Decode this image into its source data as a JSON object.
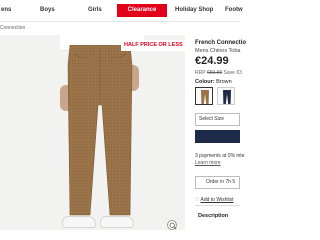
{
  "nav": {
    "items": [
      {
        "label": "ens"
      },
      {
        "label": "Boys"
      },
      {
        "label": "Girls"
      },
      {
        "label": "Clearance"
      },
      {
        "label": "Holiday Shop"
      },
      {
        "label": "Footw"
      }
    ],
    "active_color": "#e3001b"
  },
  "breadcrumb": "Connection",
  "product": {
    "promo_badge": "HALF PRICE OR LESS",
    "brand": "French Connectio",
    "subtitle": "Mens Chinos Toba",
    "price": "€24.99",
    "rrp_prefix": "RRP ",
    "rrp_was": "€59.99",
    "save": "Save €3",
    "colour_label": "Colour:",
    "colour_value": "Brown",
    "swatches": [
      {
        "name": "brown",
        "color": "#9a7448",
        "selected": true
      },
      {
        "name": "navy",
        "color": "#1e2a44",
        "selected": false
      }
    ],
    "size_placeholder": "Select Size",
    "add_button_color": "#1e2a4a",
    "payments_line1": "3 payments at 0% inte",
    "payments_link": "Learn more",
    "order_text": "Order in 7h 5",
    "wishlist": "Add to Wishlist",
    "description": "Description"
  },
  "icons": {
    "wishlist": "heart-icon",
    "zoom": "zoom-icon",
    "size_dropdown": "chevron-down-icon"
  }
}
